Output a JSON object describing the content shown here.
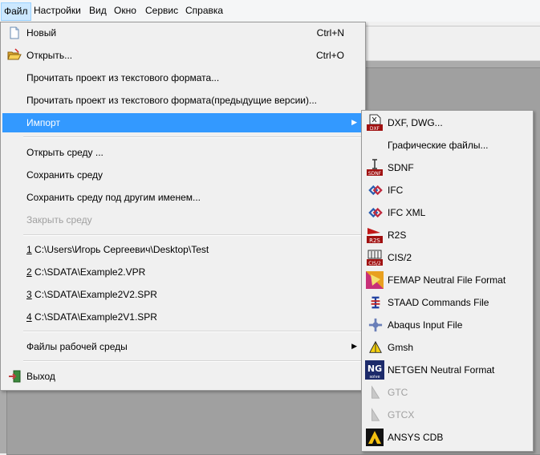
{
  "menubar": {
    "items": [
      "Файл",
      "Настройки",
      "Вид",
      "Окно",
      "Сервис",
      "Справка"
    ]
  },
  "file_menu": {
    "new": {
      "label": "Новый",
      "shortcut": "Ctrl+N",
      "icon": "new-file-icon"
    },
    "open": {
      "label": "Открыть...",
      "shortcut": "Ctrl+O",
      "icon": "open-folder-icon"
    },
    "read_text": {
      "label": "Прочитать проект из текстового формата..."
    },
    "read_text_prev": {
      "label": "Прочитать проект из текстового формата(предыдущие версии)..."
    },
    "import": {
      "label": "Импорт"
    },
    "open_env": {
      "label": "Открыть среду ..."
    },
    "save_env": {
      "label": "Сохранить среду"
    },
    "save_env_as": {
      "label": "Сохранить среду под другим именем..."
    },
    "close_env": {
      "label": "Закрыть среду"
    },
    "recent": [
      {
        "num": "1",
        "path": " C:\\Users\\Игорь Сергеевич\\Desktop\\Test"
      },
      {
        "num": "2",
        "path": " C:\\SDATA\\Example2.VPR"
      },
      {
        "num": "3",
        "path": " C:\\SDATA\\Example2V2.SPR"
      },
      {
        "num": "4",
        "path": " C:\\SDATA\\Example2V1.SPR"
      }
    ],
    "env_files": {
      "label": "Файлы рабочей среды"
    },
    "exit": {
      "label": "Выход",
      "icon": "exit-icon"
    }
  },
  "import_menu": {
    "items": [
      {
        "label": "DXF, DWG...",
        "icon": "dxf-icon",
        "enabled": true
      },
      {
        "label": "Графические файлы...",
        "icon": "",
        "enabled": true
      },
      {
        "label": "SDNF",
        "icon": "sdnf-icon",
        "enabled": true
      },
      {
        "label": "IFC",
        "icon": "ifc-icon",
        "enabled": true
      },
      {
        "label": "IFC XML",
        "icon": "ifc-icon",
        "enabled": true
      },
      {
        "label": "R2S",
        "icon": "r2s-icon",
        "enabled": true
      },
      {
        "label": "CIS/2",
        "icon": "cis2-icon",
        "enabled": true
      },
      {
        "label": "FEMAP Neutral File Format",
        "icon": "femap-icon",
        "enabled": true
      },
      {
        "label": "STAAD Commands File",
        "icon": "staad-icon",
        "enabled": true
      },
      {
        "label": "Abaqus Input File",
        "icon": "abaqus-icon",
        "enabled": true
      },
      {
        "label": "Gmsh",
        "icon": "gmsh-icon",
        "enabled": true
      },
      {
        "label": "NETGEN Neutral Format",
        "icon": "netgen-icon",
        "enabled": true
      },
      {
        "label": "GTC",
        "icon": "gtc-icon",
        "enabled": false
      },
      {
        "label": "GTCX",
        "icon": "gtc-icon",
        "enabled": false
      },
      {
        "label": "ANSYS CDB",
        "icon": "ansys-icon",
        "enabled": true
      }
    ]
  },
  "colors": {
    "highlight": "#3399ff",
    "menu_bg": "#f0f0f0",
    "disabled": "#a0a0a0"
  }
}
